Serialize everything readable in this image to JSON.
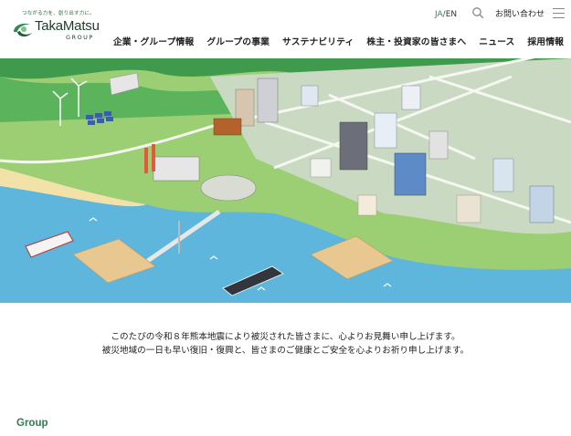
{
  "header": {
    "tagline": "つながる力を、創り出す力に。",
    "brand_name": "TakaMatsu",
    "brand_group": "GROUP",
    "lang": {
      "ja": "JA",
      "separator": "/",
      "en": "EN"
    },
    "search_icon": "search-icon",
    "contact_label": "お問い合わせ",
    "menu_icon": "hamburger-menu-icon"
  },
  "nav": {
    "items": [
      "企業・グループ情報",
      "グループの事業",
      "サステナビリティ",
      "株主・投資家の皆さまへ",
      "ニュース",
      "採用情報"
    ]
  },
  "hero": {
    "colors": {
      "sea": "#5fb6dc",
      "land": "#8fca6a",
      "beach": "#f2e2a8",
      "mountain": "#3f9a4e"
    }
  },
  "message": {
    "line1": "このたびの令和８年熊本地震により被災された皆さまに、心よりお見舞い申し上げます。",
    "line2": "被災地域の一日も早い復旧・復興と、皆さまのご健康とご安全を心よりお祈り申し上げます。"
  },
  "section": {
    "title": "Group"
  }
}
